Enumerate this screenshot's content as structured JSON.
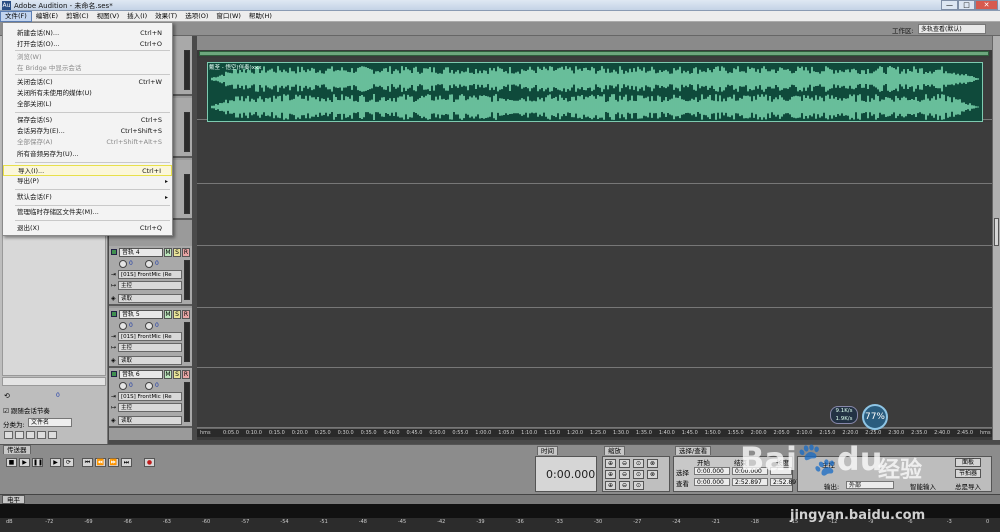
{
  "window": {
    "title": "Adobe Audition - 未命名.ses*",
    "logo_letter": "Au",
    "min": "—",
    "max": "□",
    "close": "✕"
  },
  "menubar": [
    "文件(F)",
    "编辑(E)",
    "剪辑(C)",
    "视图(V)",
    "插入(I)",
    "效果(T)",
    "选项(O)",
    "窗口(W)",
    "帮助(H)"
  ],
  "workspace": {
    "label": "工作区:",
    "value": "多轨查看(默认)"
  },
  "file_menu": {
    "items": [
      {
        "label": "新建会话(N)...",
        "shortcut": "Ctrl+N",
        "disabled": false
      },
      {
        "label": "打开会话(O)...",
        "shortcut": "Ctrl+O",
        "disabled": false
      },
      {
        "label": "浏览(W)",
        "shortcut": "",
        "disabled": true
      },
      {
        "label": "在 Bridge 中显示会话",
        "shortcut": "",
        "disabled": true
      },
      {
        "label": "关闭会话(C)",
        "shortcut": "Ctrl+W",
        "disabled": false
      },
      {
        "label": "关闭所有未使用的媒体(U)",
        "shortcut": "",
        "disabled": false
      },
      {
        "label": "全部关闭(L)",
        "shortcut": "",
        "disabled": false
      },
      {
        "label": "保存会话(S)",
        "shortcut": "Ctrl+S",
        "disabled": false
      },
      {
        "label": "会话另存为(E)...",
        "shortcut": "Ctrl+Shift+S",
        "disabled": false
      },
      {
        "label": "全部保存(A)",
        "shortcut": "Ctrl+Shift+Alt+S",
        "disabled": true
      },
      {
        "label": "所有音频另存为(U)...",
        "shortcut": "",
        "disabled": false
      },
      {
        "label": "导入(I)...",
        "shortcut": "Ctrl+I",
        "disabled": false
      },
      {
        "label": "导出(P)",
        "shortcut": "",
        "disabled": false
      },
      {
        "label": "默认会话(F)",
        "shortcut": "",
        "disabled": false
      },
      {
        "label": "管理临时存储区文件夹(M)...",
        "shortcut": "",
        "disabled": false
      },
      {
        "label": "退出(X)",
        "shortcut": "Ctrl+Q",
        "disabled": false
      }
    ]
  },
  "tracks": [
    {
      "name": "音轨 4",
      "input": "[01S] FrontMic (Re",
      "output": "主控",
      "mode": "读取"
    },
    {
      "name": "音轨 5",
      "input": "[01S] FrontMic (Re",
      "output": "主控",
      "mode": "读取"
    },
    {
      "name": "音轨 6",
      "input": "[01S] FrontMic (Re",
      "output": "主控",
      "mode": "读取"
    }
  ],
  "track_buttons": {
    "m": "M",
    "s": "S",
    "r": "R"
  },
  "knob_value": "0",
  "clip_label": "戴荃 - 悟空(伴奏)xxx",
  "ruler_ticks": [
    "hms",
    "0:05.0",
    "0:10.0",
    "0:15.0",
    "0:20.0",
    "0:25.0",
    "0:30.0",
    "0:35.0",
    "0:40.0",
    "0:45.0",
    "0:50.0",
    "0:55.0",
    "1:00.0",
    "1:05.0",
    "1:10.0",
    "1:15.0",
    "1:20.0",
    "1:25.0",
    "1:30.0",
    "1:35.0",
    "1:40.0",
    "1:45.0",
    "1:50.0",
    "1:55.0",
    "2:00.0",
    "2:05.0",
    "2:10.0",
    "2:15.0",
    "2:20.0",
    "2:25.0",
    "2:30.0",
    "2:35.0",
    "2:40.0",
    "2:45.0",
    "hms"
  ],
  "left_panel": {
    "follow_label": "跟随会话节奏",
    "sort_label": "分类为:",
    "sort_value": "文件名",
    "val": "0"
  },
  "transport": {
    "tab": "传送器",
    "time_tab": "时间",
    "time_value": "0:00.000",
    "zoom_tab": "缩放",
    "sel_tab": "选择/查看"
  },
  "selection": {
    "start_label": "开始",
    "end_label": "结束",
    "len_label": "长度",
    "sel_label": "选择",
    "view_label": "查看",
    "sel_start": "0:00.000",
    "sel_end": "0:00.000",
    "view_start": "0:00.000",
    "view_end": "2:52.897",
    "view_len": "2:52.897"
  },
  "right_panel": {
    "master_label": "主控",
    "out_label": "输出:",
    "out_value": "外部",
    "rec_label": "智能输入",
    "btn1": "面板",
    "btn2": "节拍器",
    "btn3": "总是导入"
  },
  "levels": {
    "tab": "电平",
    "scale": [
      "dB",
      "-72",
      "-69",
      "-66",
      "-63",
      "-60",
      "-57",
      "-54",
      "-51",
      "-48",
      "-45",
      "-42",
      "-39",
      "-36",
      "-33",
      "-30",
      "-27",
      "-24",
      "-21",
      "-18",
      "-15",
      "-12",
      "-9",
      "-6",
      "-3",
      "0"
    ]
  },
  "overlay": {
    "speed": "9.1K/s",
    "speed2": "1.9K/s",
    "pct": "77%",
    "watermark1": "Bai",
    "watermark_mid": "du",
    "watermark2": "经验",
    "url": "jingyan.baidu.com"
  },
  "colors": {
    "waveform": "#8ef0c4",
    "clip_bg": "#0f4a3b",
    "highlight": "#e8e04a"
  }
}
